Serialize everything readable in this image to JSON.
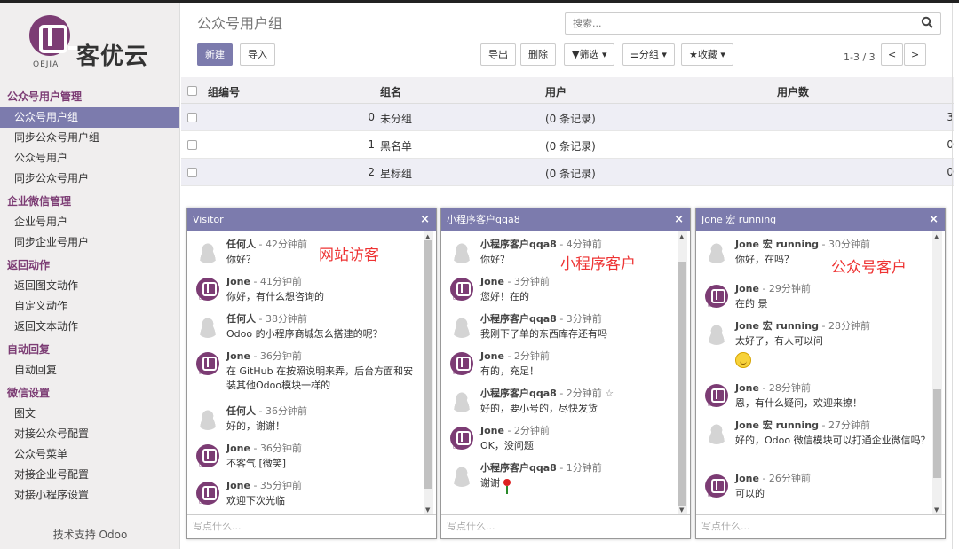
{
  "app": {
    "brand_small": "OEJIA",
    "brand_name": "客优云"
  },
  "sidebar": {
    "sections": [
      {
        "title": "公众号用户管理",
        "items": [
          "公众号用户组",
          "同步公众号用户组",
          "公众号用户",
          "同步公众号用户"
        ]
      },
      {
        "title": "企业微信管理",
        "items": [
          "企业号用户",
          "同步企业号用户"
        ]
      },
      {
        "title": "返回动作",
        "items": [
          "返回图文动作",
          "自定义动作",
          "返回文本动作"
        ]
      },
      {
        "title": "自动回复",
        "items": [
          "自动回复"
        ]
      },
      {
        "title": "微信设置",
        "items": [
          "图文",
          "对接公众号配置",
          "公众号菜单",
          "对接企业号配置",
          "对接小程序设置"
        ]
      }
    ],
    "active_item": "公众号用户组",
    "support": "技术支持 Odoo"
  },
  "control_panel": {
    "title": "公众号用户组",
    "search_placeholder": "搜索...",
    "buttons": {
      "new": "新建",
      "import": "导入",
      "export": "导出",
      "delete": "删除",
      "filter": "▼筛选 ▾",
      "group": "☰分组 ▾",
      "favorite": "★收藏 ▾"
    },
    "pager": "1-3 / 3",
    "prev": "<",
    "next": ">"
  },
  "table": {
    "columns": [
      "组编号",
      "组名",
      "用户",
      "用户数"
    ],
    "rows": [
      {
        "id": "0",
        "name": "未分组",
        "users": "(0 条记录)",
        "count": "3"
      },
      {
        "id": "1",
        "name": "黑名单",
        "users": "(0 条记录)",
        "count": "0"
      },
      {
        "id": "2",
        "name": "星标组",
        "users": "(0 条记录)",
        "count": "0"
      }
    ]
  },
  "chats": [
    {
      "title": "Visitor",
      "annotation": "网站访客",
      "input_placeholder": "写点什么...",
      "messages": [
        {
          "author": "任何人",
          "time": " - 42分钟前",
          "text": "你好？",
          "avatar": "gray"
        },
        {
          "author": "Jone",
          "time": " - 41分钟前",
          "text": "你好，有什么想咨询的",
          "avatar": "logo"
        },
        {
          "author": "任何人",
          "time": " - 38分钟前",
          "text": "Odoo 的小程序商城怎么搭建的呢？",
          "avatar": "gray"
        },
        {
          "author": "Jone",
          "time": " - 36分钟前",
          "text": "在 GitHub 在按照说明来弄，后台方面和安装其他Odoo模块一样的",
          "avatar": "logo"
        },
        {
          "author": "任何人",
          "time": " - 36分钟前",
          "text": "好的，谢谢！",
          "avatar": "gray"
        },
        {
          "author": "Jone",
          "time": " - 36分钟前",
          "text": "不客气 [微笑]",
          "avatar": "logo"
        },
        {
          "author": "Jone",
          "time": " - 35分钟前",
          "text": "欢迎下次光临",
          "avatar": "logo"
        }
      ]
    },
    {
      "title": "小程序客户qqa8",
      "annotation": "小程序客户",
      "input_placeholder": "写点什么...",
      "messages": [
        {
          "author": "小程序客户qqa8",
          "time": " - 4分钟前",
          "text": "你好？",
          "avatar": "gray"
        },
        {
          "author": "Jone",
          "time": " - 3分钟前",
          "text": "您好！在的",
          "avatar": "logo"
        },
        {
          "author": "小程序客户qqa8",
          "time": " - 3分钟前",
          "text": "我刚下了单的东西库存还有吗",
          "avatar": "gray"
        },
        {
          "author": "Jone",
          "time": " - 2分钟前",
          "text": "有的，充足！",
          "avatar": "logo"
        },
        {
          "author": "小程序客户qqa8",
          "time": " - 2分钟前  ☆",
          "text": "好的，要小号的，尽快发货",
          "avatar": "gray"
        },
        {
          "author": "Jone",
          "time": " - 2分钟前",
          "text": "OK，没问题",
          "avatar": "logo"
        },
        {
          "author": "小程序客户qqa8",
          "time": " - 1分钟前",
          "text": "谢谢",
          "avatar": "gray",
          "rose": true
        }
      ]
    },
    {
      "title": "Jone 宏 running",
      "annotation": "公众号客户",
      "input_placeholder": "写点什么...",
      "messages": [
        {
          "author": "Jone 宏 running",
          "time": " - 30分钟前",
          "text": "你好，在吗？",
          "avatar": "gray"
        },
        {
          "author": "Jone",
          "time": " - 29分钟前",
          "text": "在的 景",
          "avatar": "logo"
        },
        {
          "author": "Jone 宏 running",
          "time": " - 28分钟前",
          "text": "太好了，有人可以问",
          "avatar": "gray",
          "smile": true
        },
        {
          "author": "Jone",
          "time": " - 28分钟前",
          "text": "恩，有什么疑问，欢迎来撩！",
          "avatar": "logo"
        },
        {
          "author": "Jone 宏 running",
          "time": " - 27分钟前",
          "text": "好的，Odoo 微信模块可以打通企业微信吗？",
          "avatar": "gray"
        },
        {
          "author": "Jone",
          "time": " - 26分钟前",
          "text": "可以的",
          "avatar": "logo"
        }
      ]
    }
  ]
}
